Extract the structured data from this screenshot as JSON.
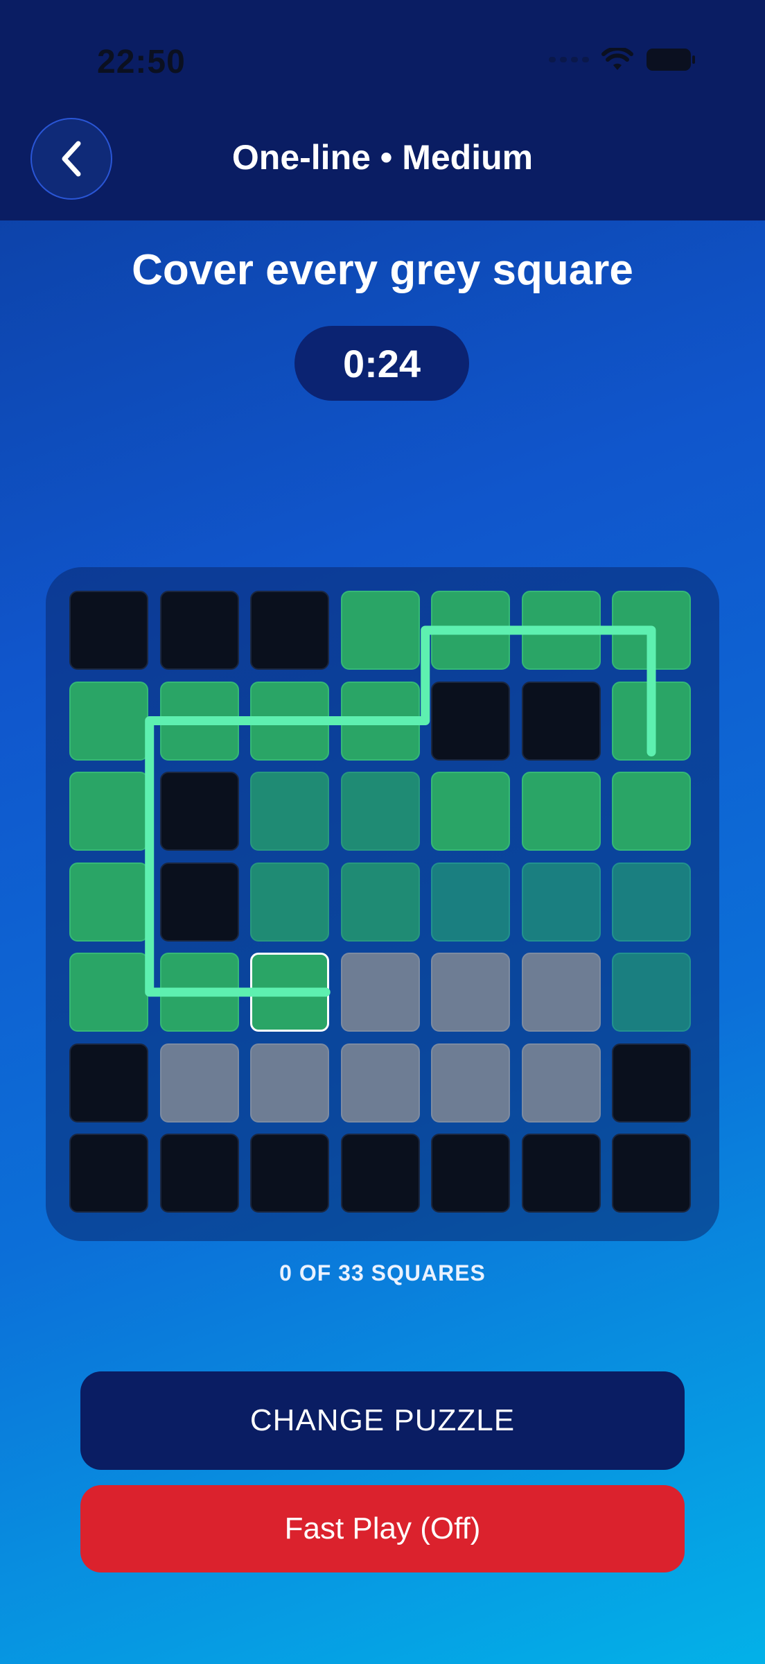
{
  "status_bar": {
    "time": "22:50"
  },
  "header": {
    "title": "One-line • Medium"
  },
  "heading": "Cover every grey square",
  "timer": "0:24",
  "board": {
    "rows": 7,
    "cols": 7,
    "grid": [
      [
        "black",
        "black",
        "black",
        "green",
        "green",
        "green",
        "green"
      ],
      [
        "green",
        "green",
        "green",
        "green",
        "black",
        "black",
        "green"
      ],
      [
        "green",
        "black",
        "teal",
        "teal",
        "green",
        "green",
        "green"
      ],
      [
        "green",
        "black",
        "teal",
        "teal",
        "teal2",
        "teal2",
        "teal2"
      ],
      [
        "green",
        "green",
        "current",
        "grey",
        "grey",
        "grey",
        "teal2"
      ],
      [
        "black",
        "grey",
        "grey",
        "grey",
        "grey",
        "grey",
        "black"
      ],
      [
        "black",
        "black",
        "black",
        "black",
        "black",
        "black",
        "black"
      ]
    ],
    "path_color": "#5ef0b0"
  },
  "progress": "0 OF 33 SQUARES",
  "buttons": {
    "change": "CHANGE PUZZLE",
    "fast_play": "Fast Play (Off)"
  }
}
